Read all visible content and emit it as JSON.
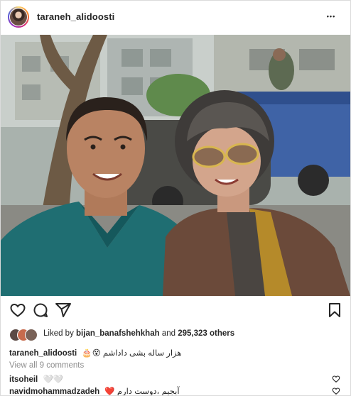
{
  "post": {
    "username": "taraneh_alidoosti",
    "more_icon": "•••"
  },
  "photo": {
    "alt": "Selfie of a smiling man in a teal sweater and a smiling woman in sunglasses and a brown coat on a city street"
  },
  "likes": {
    "prefix": "Liked by ",
    "user": "bijan_banafshehkhah",
    "mid": " and ",
    "count": "295,323 others"
  },
  "caption": {
    "username": "taraneh_alidoosti",
    "text": "هزار ساله بشی داداشم 😵🎂"
  },
  "comments_link": "View all 9 comments",
  "comments": [
    {
      "username": "itsoheil",
      "text": "🤍🤍"
    },
    {
      "username": "navidmohammadzadeh",
      "text": "آبجیم ،دوست دارم ❤️"
    }
  ],
  "colors": {
    "border": "#dbdbdb",
    "muted": "#8e8e8e",
    "heart_teal": "#3fb8c4",
    "heart_red": "#c0392b"
  }
}
